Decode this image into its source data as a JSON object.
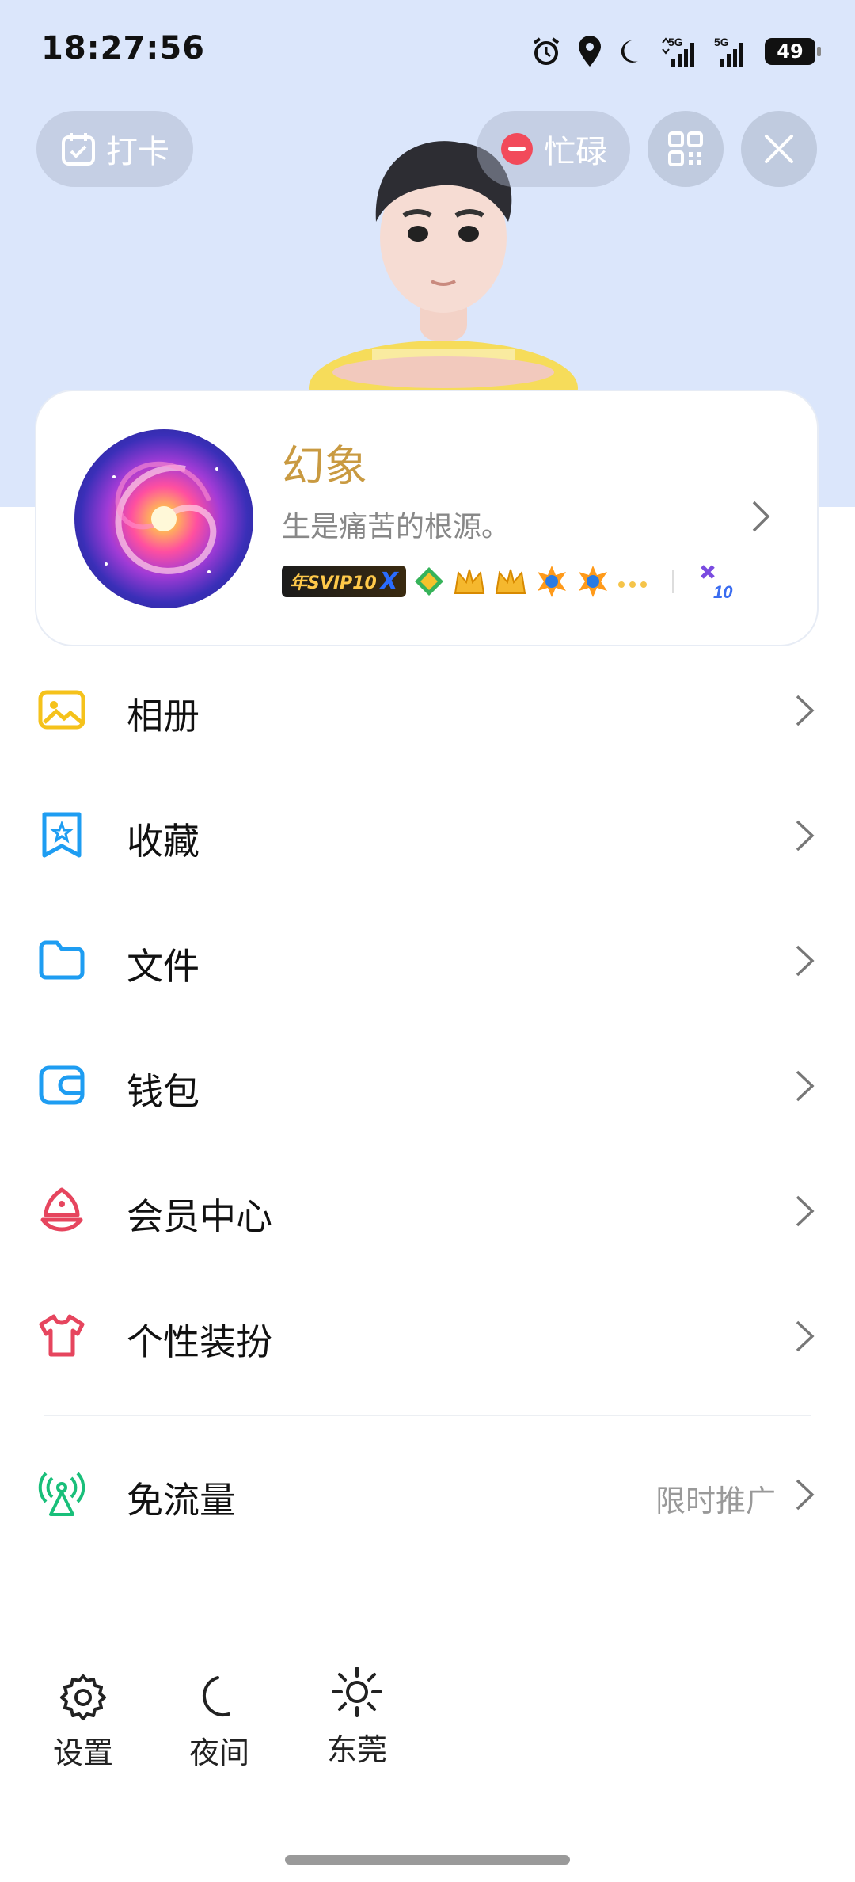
{
  "status_bar": {
    "time": "18:27:56",
    "net1": "5G",
    "net2": "5G",
    "battery": "49"
  },
  "top_actions": {
    "checkin_label": "打卡",
    "busy_label": "忙碌"
  },
  "profile": {
    "name": "幻象",
    "signature": "生是痛苦的根源。",
    "vip_badge": "年SVIP10"
  },
  "menu": [
    {
      "label": "相册",
      "icon": "photo-album-icon"
    },
    {
      "label": "收藏",
      "icon": "favorites-icon"
    },
    {
      "label": "文件",
      "icon": "folder-icon"
    },
    {
      "label": "钱包",
      "icon": "wallet-icon"
    },
    {
      "label": "会员中心",
      "icon": "member-center-icon"
    },
    {
      "label": "个性装扮",
      "icon": "tshirt-icon"
    }
  ],
  "free_data": {
    "label": "免流量",
    "extra": "限时推广",
    "icon": "signal-tower-icon"
  },
  "bottom_bar": {
    "settings": "设置",
    "night": "夜间",
    "weather": "东莞"
  },
  "colors": {
    "header_bg": "#dbe6fb",
    "username": "#c99a41",
    "accent_blue": "#1e9df2"
  }
}
